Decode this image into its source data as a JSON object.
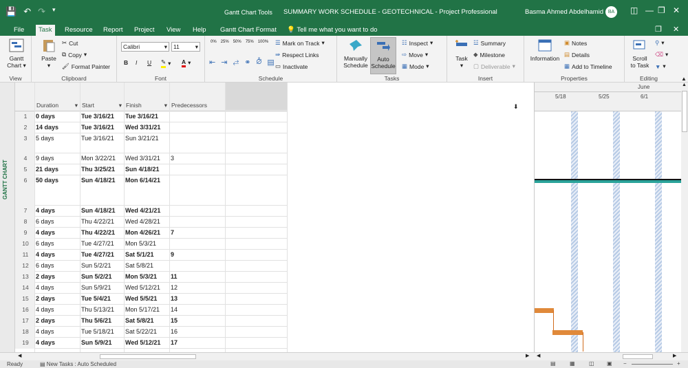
{
  "titlebar": {
    "context_label": "Gantt Chart Tools",
    "document_title": "SUMMARY WORK SCHEDULE - GEOTECHNICAL  -  Project Professional",
    "user_name": "Basma Ahmed Abdelhamid",
    "user_initials": "BA"
  },
  "tabs": [
    "File",
    "Task",
    "Resource",
    "Report",
    "Project",
    "View",
    "Help",
    "Gantt Chart Format"
  ],
  "tell_me": "Tell me what you want to do",
  "ribbon": {
    "view": {
      "gantt": "Gantt",
      "chart": "Chart",
      "label": "View"
    },
    "clipboard": {
      "paste": "Paste",
      "cut": "Cut",
      "copy": "Copy",
      "format_painter": "Format Painter",
      "label": "Clipboard"
    },
    "font": {
      "name": "Calibri",
      "size": "11",
      "bold": "B",
      "italic": "I",
      "underline": "U",
      "label": "Font"
    },
    "schedule": {
      "mark_on_track": "Mark on Track",
      "respect_links": "Respect Links",
      "inactivate": "Inactivate",
      "label": "Schedule",
      "pct": [
        "0%",
        "25%",
        "50%",
        "75%",
        "100%"
      ]
    },
    "tasks": {
      "manually": "Manually",
      "schedule1": "Schedule",
      "auto": "Auto",
      "schedule2": "Schedule",
      "inspect": "Inspect",
      "move": "Move",
      "mode": "Mode",
      "label": "Tasks"
    },
    "insert": {
      "task": "Task",
      "summary": "Summary",
      "milestone": "Milestone",
      "deliverable": "Deliverable",
      "label": "Insert"
    },
    "properties": {
      "information": "Information",
      "notes": "Notes",
      "details": "Details",
      "add_to_timeline": "Add to Timeline",
      "label": "Properties"
    },
    "editing": {
      "scroll": "Scroll",
      "to_task": "to Task",
      "label": "Editing"
    }
  },
  "side_label": "GANTT CHART",
  "columns": [
    "Duration",
    "Start",
    "Finish",
    "Predecessors"
  ],
  "rows": [
    {
      "n": "1",
      "dur": "0 days",
      "start": "Tue 3/16/21",
      "fin": "Tue 3/16/21",
      "pred": "",
      "bold": true
    },
    {
      "n": "2",
      "dur": "14 days",
      "start": "Tue 3/16/21",
      "fin": "Wed 3/31/21",
      "pred": "",
      "bold": true
    },
    {
      "n": "3",
      "dur": "5 days",
      "start": "Tue 3/16/21",
      "fin": "Sun 3/21/21",
      "pred": "",
      "bold": false
    },
    {
      "n": "4",
      "dur": "9 days",
      "start": "Mon 3/22/21",
      "fin": "Wed 3/31/21",
      "pred": "3",
      "bold": false
    },
    {
      "n": "5",
      "dur": "21 days",
      "start": "Thu 3/25/21",
      "fin": "Sun 4/18/21",
      "pred": "",
      "bold": true
    },
    {
      "n": "6",
      "dur": "50 days",
      "start": "Sun 4/18/21",
      "fin": "Mon 6/14/21",
      "pred": "",
      "bold": true
    },
    {
      "n": "7",
      "dur": "4 days",
      "start": "Sun 4/18/21",
      "fin": "Wed 4/21/21",
      "pred": "",
      "bold": true
    },
    {
      "n": "8",
      "dur": "6 days",
      "start": "Thu 4/22/21",
      "fin": "Wed 4/28/21",
      "pred": "",
      "bold": false
    },
    {
      "n": "9",
      "dur": "4 days",
      "start": "Thu 4/22/21",
      "fin": "Mon 4/26/21",
      "pred": "7",
      "bold": true
    },
    {
      "n": "10",
      "dur": "6 days",
      "start": "Tue 4/27/21",
      "fin": "Mon 5/3/21",
      "pred": "",
      "bold": false
    },
    {
      "n": "11",
      "dur": "4 days",
      "start": "Tue 4/27/21",
      "fin": "Sat 5/1/21",
      "pred": "9",
      "bold": true
    },
    {
      "n": "12",
      "dur": "6 days",
      "start": "Sun 5/2/21",
      "fin": "Sat 5/8/21",
      "pred": "",
      "bold": false
    },
    {
      "n": "13",
      "dur": "2 days",
      "start": "Sun 5/2/21",
      "fin": "Mon 5/3/21",
      "pred": "11",
      "bold": true
    },
    {
      "n": "14",
      "dur": "4 days",
      "start": "Sun 5/9/21",
      "fin": "Wed 5/12/21",
      "pred": "12",
      "bold": false
    },
    {
      "n": "15",
      "dur": "2 days",
      "start": "Tue 5/4/21",
      "fin": "Wed 5/5/21",
      "pred": "13",
      "bold": true
    },
    {
      "n": "16",
      "dur": "4 days",
      "start": "Thu 5/13/21",
      "fin": "Mon 5/17/21",
      "pred": "14",
      "bold": false
    },
    {
      "n": "17",
      "dur": "2 days",
      "start": "Thu 5/6/21",
      "fin": "Sat 5/8/21",
      "pred": "15",
      "bold": true
    },
    {
      "n": "18",
      "dur": "4 days",
      "start": "Tue 5/18/21",
      "fin": "Sat 5/22/21",
      "pred": "16",
      "bold": false
    },
    {
      "n": "19",
      "dur": "4 days",
      "start": "Sun 5/9/21",
      "fin": "Wed 5/12/21",
      "pred": "17",
      "bold": true
    }
  ],
  "timescale": {
    "month": "June",
    "weeks": [
      "5/18",
      "5/25",
      "6/1"
    ]
  },
  "status": {
    "ready": "Ready",
    "new_tasks": "New Tasks : Auto Scheduled"
  },
  "colors": {
    "brand": "#217346",
    "bar": "#e0893a",
    "summary": "#2aa39a",
    "nonworking": "#b7cbe6"
  }
}
